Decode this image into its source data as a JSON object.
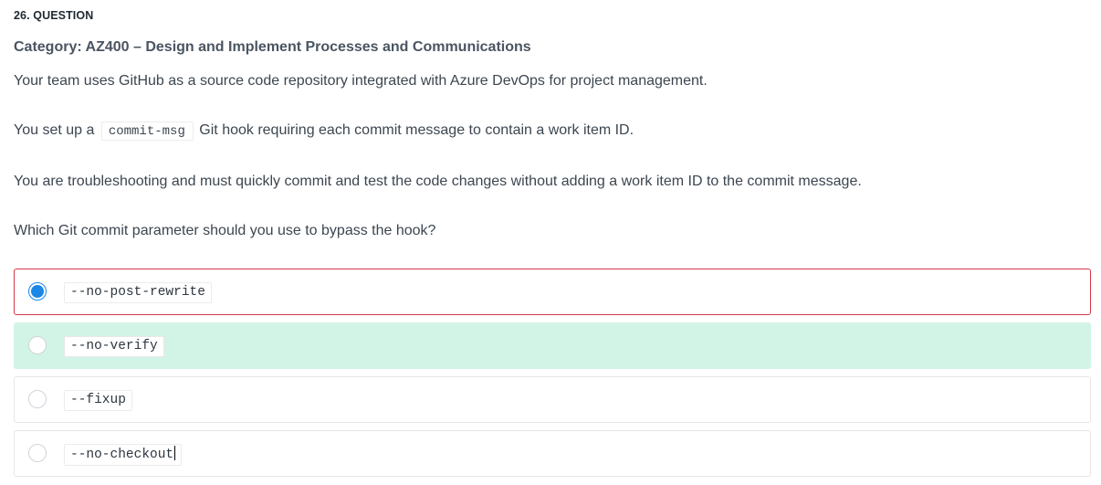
{
  "question": {
    "number": "26. QUESTION",
    "category": "Category: AZ400 – Design and Implement Processes and Communications",
    "paragraph1": "Your team uses GitHub as a source code repository integrated with Azure DevOps for project management.",
    "paragraph2_before": "You set up a",
    "paragraph2_code": "commit-msg",
    "paragraph2_after": "Git hook requiring each commit message to contain a work item ID.",
    "paragraph3": "You are troubleshooting and must quickly commit and test the code changes without adding a work item ID to the commit message.",
    "paragraph4": "Which Git commit parameter should you use to bypass the hook?"
  },
  "options": [
    {
      "label": "--no-post-rewrite",
      "selected": true,
      "state": "incorrect"
    },
    {
      "label": "--no-verify",
      "selected": false,
      "state": "correct"
    },
    {
      "label": "--fixup",
      "selected": false,
      "state": "neutral"
    },
    {
      "label": "--no-checkout",
      "selected": false,
      "state": "neutral"
    }
  ],
  "colors": {
    "selected_radio": "#1b87e6",
    "incorrect_border": "#d3384a",
    "correct_background": "#d2f4e6"
  }
}
